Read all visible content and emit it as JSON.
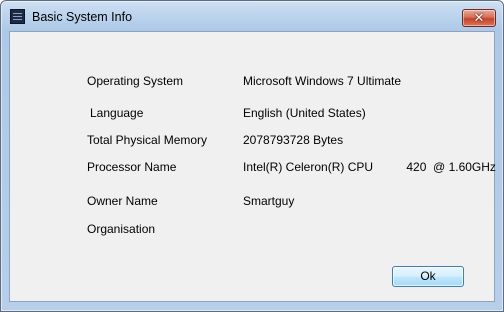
{
  "window": {
    "title": "Basic System Info",
    "app_icon": "app-list-icon",
    "close_icon": "close-icon",
    "close_glyph": "✕"
  },
  "info": {
    "os_label": "Operating System",
    "os_value": "Microsoft Windows 7 Ultimate",
    "language_label": "Language",
    "language_value": "English (United States)",
    "memory_label": "Total Physical Memory",
    "memory_value": "2078793728 Bytes",
    "processor_label": "Processor Name",
    "processor_value": "Intel(R) Celeron(R) CPU          420  @ 1.60GHz",
    "owner_label": "Owner Name",
    "owner_value": "Smartguy",
    "organisation_label": "Organisation",
    "organisation_value": ""
  },
  "buttons": {
    "ok_label": "Ok"
  },
  "colors": {
    "frame": "#b7cfe9",
    "close_button": "#c4432b",
    "client_bg": "#f0f0f0",
    "ok_border": "#3c7fb1"
  }
}
